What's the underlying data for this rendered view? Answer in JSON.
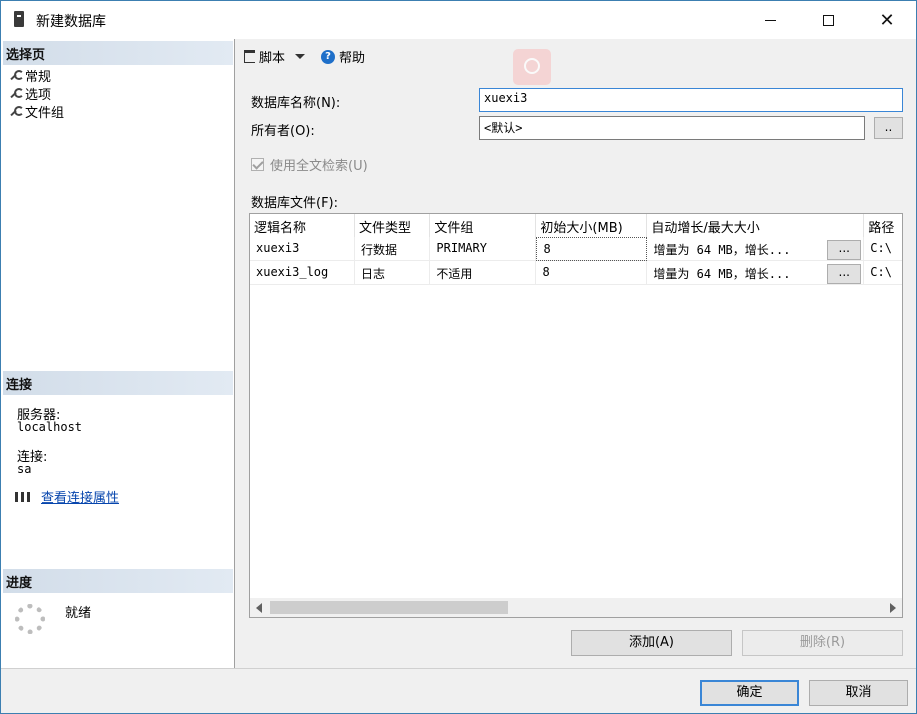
{
  "window": {
    "title": "新建数据库",
    "min_symbol": "",
    "max_symbol": "",
    "close_symbol": "✕"
  },
  "left": {
    "select_page_header": "选择页",
    "pages": [
      {
        "label": "常规",
        "icon": "wrench-icon"
      },
      {
        "label": "选项",
        "icon": "wrench-icon"
      },
      {
        "label": "文件组",
        "icon": "wrench-icon"
      }
    ],
    "connection_header": "连接",
    "server_label": "服务器:",
    "server_value": "localhost",
    "connection_label": "连接:",
    "connection_value": "sa",
    "view_properties_link": "查看连接属性",
    "progress_header": "进度",
    "progress_status": "就绪"
  },
  "toolbar": {
    "script_label": "脚本",
    "help_label": "帮助"
  },
  "form": {
    "db_name_label": "数据库名称(N):",
    "db_name_value": "xuexi3",
    "owner_label": "所有者(O):",
    "owner_value": "<默认>",
    "owner_browse": "..",
    "fulltext_label": "使用全文检索(U)",
    "fulltext_checked": true,
    "files_label": "数据库文件(F):"
  },
  "grid": {
    "columns": [
      "逻辑名称",
      "文件类型",
      "文件组",
      "初始大小(MB)",
      "自动增长/最大大小",
      "路径"
    ],
    "rows": [
      {
        "logical_name": "xuexi3",
        "file_type": "行数据",
        "filegroup": "PRIMARY",
        "initial_size": "8",
        "autogrowth": "增量为 64 MB，增长...",
        "browse": "...",
        "path": "C:\\"
      },
      {
        "logical_name": "xuexi3_log",
        "file_type": "日志",
        "filegroup": "不适用",
        "initial_size": "8",
        "autogrowth": "增量为 64 MB，增长...",
        "browse": "...",
        "path": "C:\\"
      }
    ]
  },
  "actions": {
    "add": "添加(A)",
    "remove": "删除(R)",
    "ok": "确定",
    "cancel": "取消"
  },
  "colors": {
    "accent": "#3a86d6",
    "link": "#0645ad",
    "section_header": "#d2dde9"
  }
}
